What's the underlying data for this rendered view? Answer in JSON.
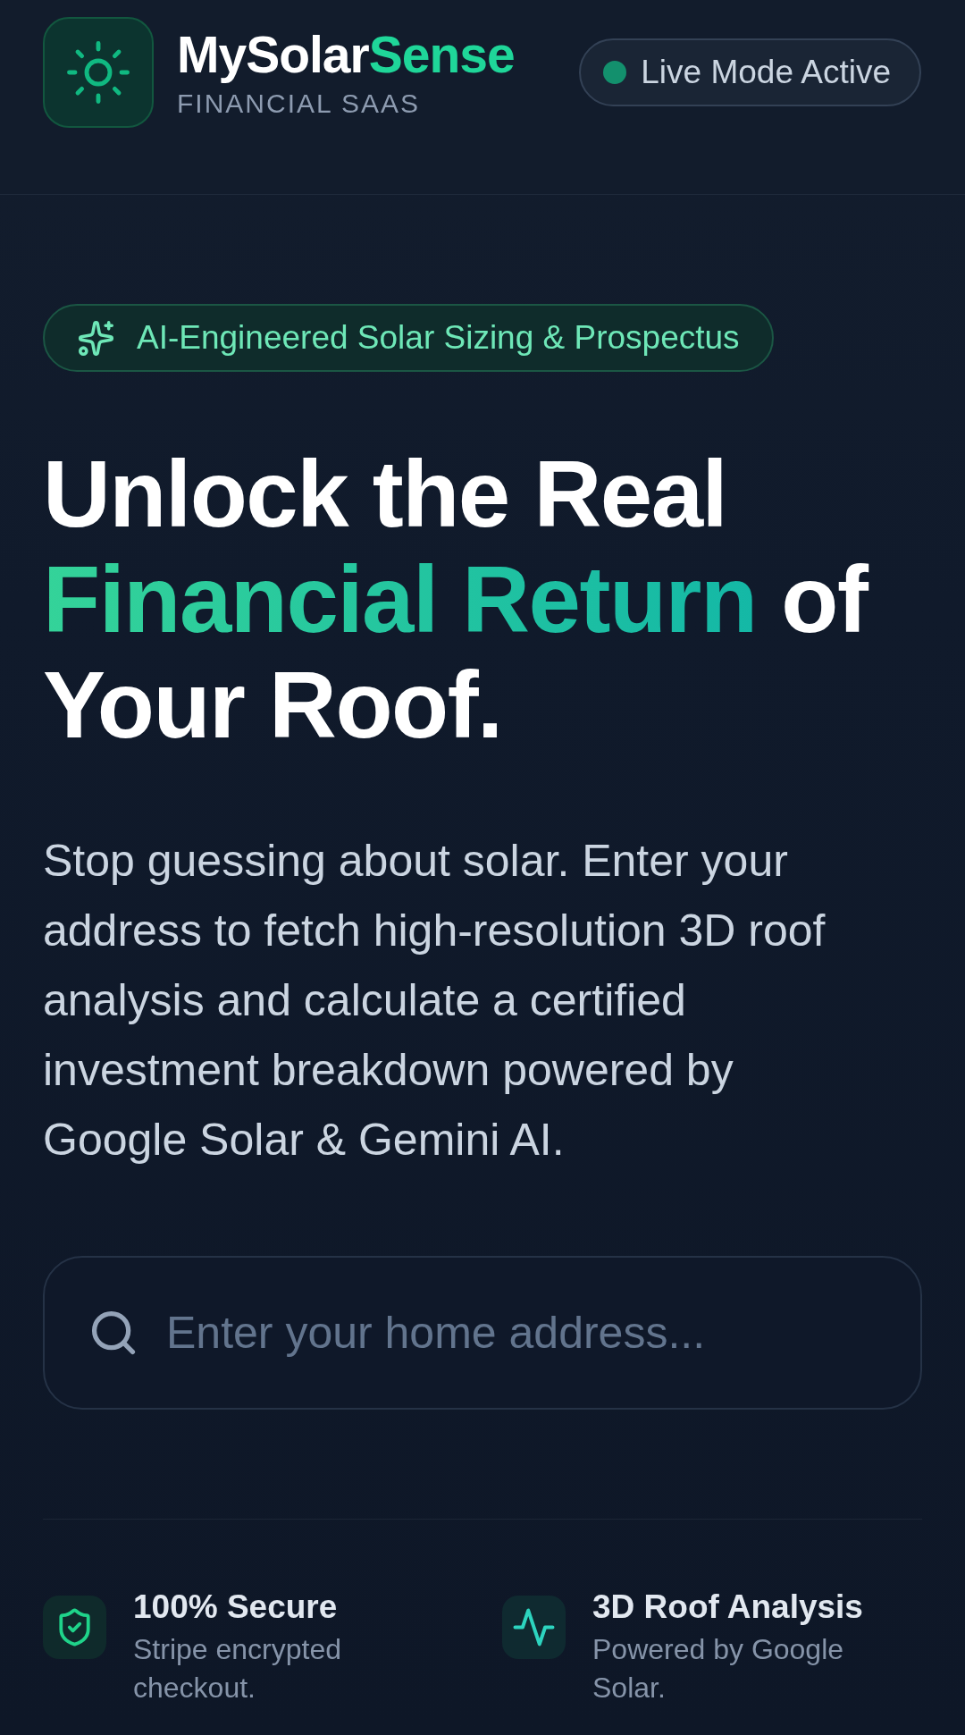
{
  "header": {
    "brand": {
      "name": [
        {
          "text": "MySolar",
          "accent": false
        },
        {
          "text": "Sense",
          "accent": true
        }
      ],
      "tagline": "FINANCIAL SAAS"
    },
    "status": {
      "label": "Live Mode Active",
      "active": true
    }
  },
  "hero": {
    "badge": "AI-Engineered Solar Sizing & Prospectus",
    "headline": [
      {
        "text": "Unlock the Real ",
        "highlight": false
      },
      {
        "text": "Financial Return",
        "highlight": true
      },
      {
        "text": " of Your Roof.",
        "highlight": false
      }
    ],
    "description": "Stop guessing about solar. Enter your address to fetch high-resolution 3D roof analysis and calculate a certified investment breakdown powered by Google Solar & Gemini AI.",
    "search": {
      "placeholder": "Enter your home address..."
    }
  },
  "features": [
    {
      "kind": "shield",
      "title": "100% Secure",
      "subtitle": "Stripe encrypted checkout."
    },
    {
      "kind": "pulse",
      "title": "3D Roof Analysis",
      "subtitle": "Powered by Google Solar."
    }
  ]
}
